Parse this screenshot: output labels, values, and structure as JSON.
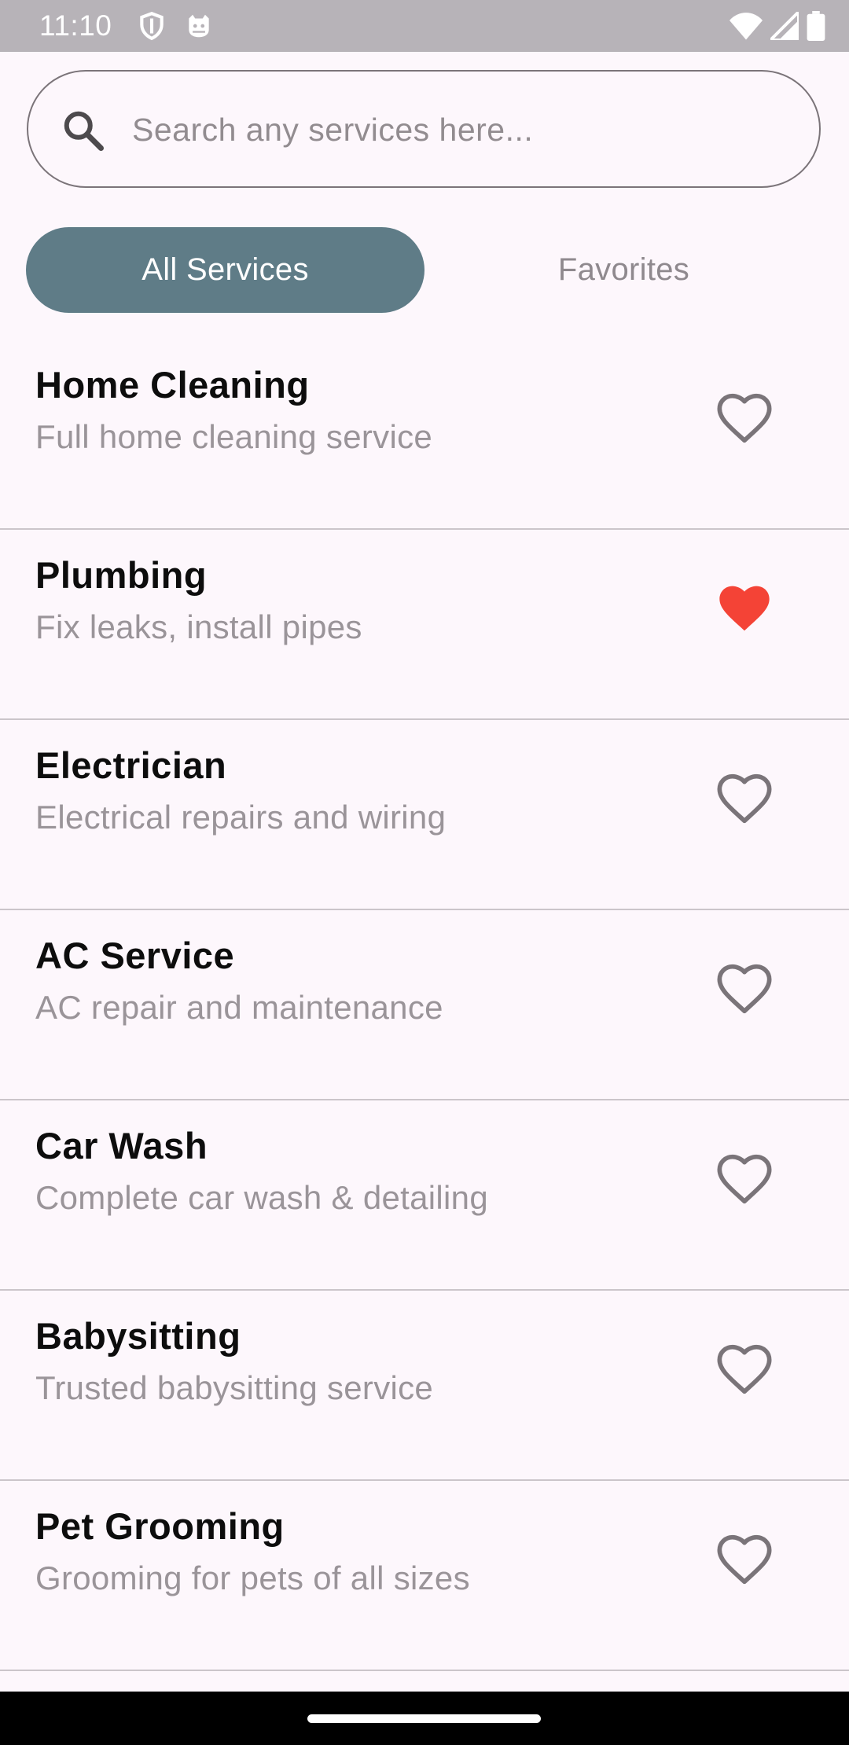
{
  "status_bar": {
    "time": "11:10",
    "icons": [
      "shield-icon",
      "cat-face-icon",
      "wifi-icon",
      "signal-icon",
      "battery-icon"
    ]
  },
  "search": {
    "placeholder": "Search any services here...",
    "value": ""
  },
  "tabs": [
    {
      "label": "All Services",
      "selected": true
    },
    {
      "label": "Favorites",
      "selected": false
    }
  ],
  "colors": {
    "accent": "#5f7c87",
    "favorite": "#f44336",
    "background": "#fdf7fc"
  },
  "services": [
    {
      "title": "Home Cleaning",
      "description": "Full home cleaning service",
      "favorite": false
    },
    {
      "title": "Plumbing",
      "description": "Fix leaks, install pipes",
      "favorite": true
    },
    {
      "title": "Electrician",
      "description": "Electrical repairs and wiring",
      "favorite": false
    },
    {
      "title": "AC Service",
      "description": "AC repair and maintenance",
      "favorite": false
    },
    {
      "title": "Car Wash",
      "description": "Complete car wash & detailing",
      "favorite": false
    },
    {
      "title": "Babysitting",
      "description": "Trusted babysitting service",
      "favorite": false
    },
    {
      "title": "Pet Grooming",
      "description": "Grooming for pets of all sizes",
      "favorite": false
    }
  ]
}
